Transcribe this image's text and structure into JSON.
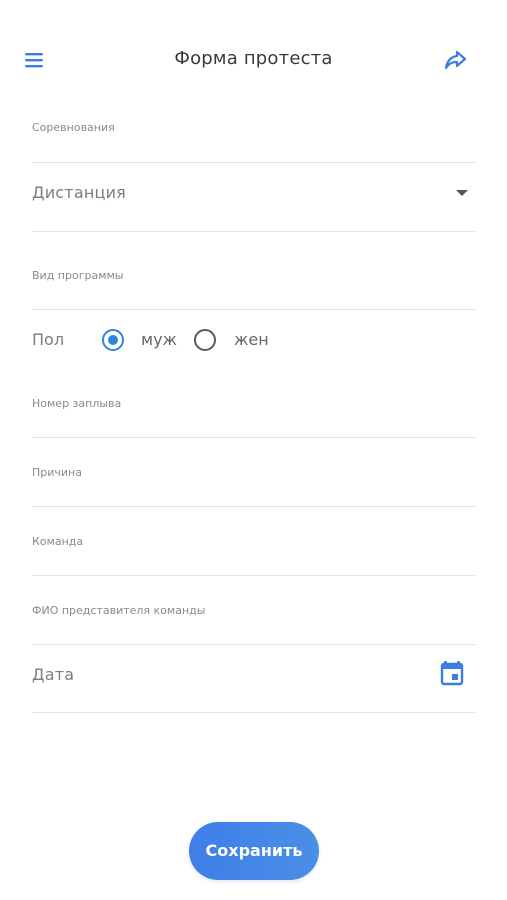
{
  "header": {
    "title": "Форма протеста",
    "menu_icon": "menu-icon",
    "share_icon": "share-icon"
  },
  "form": {
    "competitions": {
      "label": "Соревнования"
    },
    "distance": {
      "label": "Дистанция",
      "icon": "chevron-down-icon"
    },
    "program_type": {
      "label": "Вид программы"
    },
    "gender": {
      "label": "Пол",
      "options": [
        {
          "label": "муж",
          "checked": true
        },
        {
          "label": "жен",
          "checked": false
        }
      ]
    },
    "heat_number": {
      "label": "Номер заплыва"
    },
    "reason": {
      "label": "Причина"
    },
    "team": {
      "label": "Команда"
    },
    "team_rep": {
      "label": "ФИО представителя команды"
    },
    "date": {
      "label": "Дата",
      "icon": "calendar-icon"
    }
  },
  "actions": {
    "save_label": "Сохранить"
  },
  "colors": {
    "accent": "#2f86e0",
    "button_start": "#3f7ee8",
    "button_end": "#4a8fe6",
    "divider": "#e3e3e3"
  }
}
